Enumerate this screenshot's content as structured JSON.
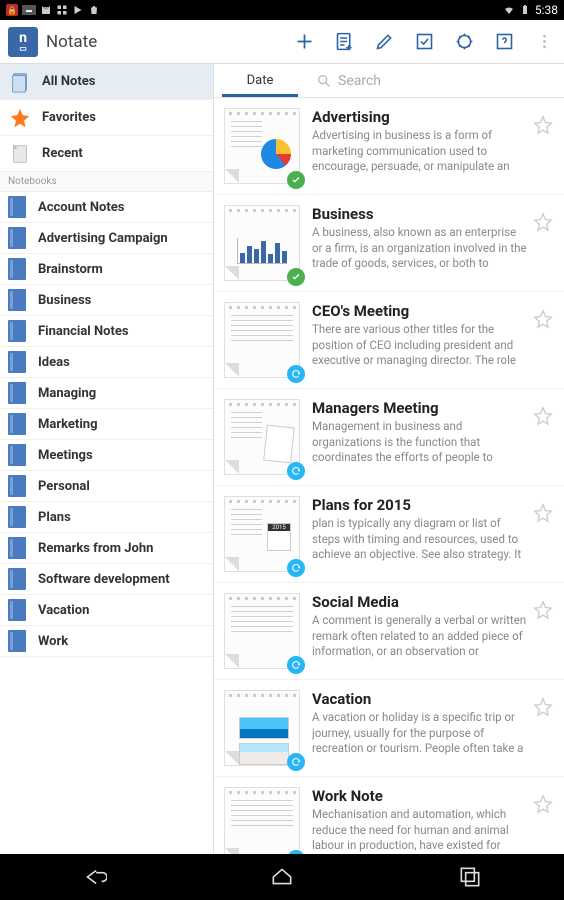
{
  "status": {
    "time": "5:38"
  },
  "header": {
    "title": "Notate",
    "actions": [
      "add",
      "add-note",
      "pen",
      "checkbox",
      "settings",
      "help",
      "overflow"
    ]
  },
  "sidebar": {
    "nav": [
      {
        "id": "all",
        "label": "All Notes",
        "selected": true
      },
      {
        "id": "favorites",
        "label": "Favorites"
      },
      {
        "id": "recent",
        "label": "Recent"
      }
    ],
    "section": "Notebooks",
    "notebooks": [
      {
        "label": "Account Notes"
      },
      {
        "label": "Advertising Campaign"
      },
      {
        "label": "Brainstorm"
      },
      {
        "label": "Business"
      },
      {
        "label": "Financial Notes"
      },
      {
        "label": "Ideas"
      },
      {
        "label": "Managing"
      },
      {
        "label": "Marketing"
      },
      {
        "label": "Meetings"
      },
      {
        "label": "Personal"
      },
      {
        "label": "Plans"
      },
      {
        "label": "Remarks from John"
      },
      {
        "label": "Software development"
      },
      {
        "label": "Vacation"
      },
      {
        "label": "Work"
      }
    ]
  },
  "content": {
    "tab_date": "Date",
    "search_placeholder": "Search",
    "notes": [
      {
        "title": "Advertising",
        "desc": "Advertising in business is a form of marketing communication used to encourage, persuade, or manipulate an",
        "status": "ok",
        "thumb": "pie"
      },
      {
        "title": "Business",
        "desc": "A business, also known as an enterprise or a firm, is an organization involved in the trade of goods, services, or both to",
        "status": "ok",
        "thumb": "bars"
      },
      {
        "title": "CEO's Meeting",
        "desc": "There are various other titles for the position of CEO including president and executive or managing director. The role",
        "status": "sync",
        "thumb": "text"
      },
      {
        "title": "Managers Meeting",
        "desc": "Management in business and organizations is the function that coordinates the efforts of people to",
        "status": "sync",
        "thumb": "paper"
      },
      {
        "title": "Plans for 2015",
        "desc": "plan is typically any diagram or list of steps with timing and resources, used to achieve an objective. See also strategy. It",
        "status": "sync",
        "thumb": "cal"
      },
      {
        "title": "Social Media",
        "desc": "A comment is generally a verbal or written remark often related to an added piece of information, or an observation or",
        "status": "sync",
        "thumb": "text"
      },
      {
        "title": "Vacation",
        "desc": "A vacation or holiday is a specific trip or journey, usually for the purpose of recreation or tourism. People often take a",
        "status": "sync",
        "thumb": "photos"
      },
      {
        "title": "Work Note",
        "desc": "Mechanisation and automation, which reduce the need for human and animal labour in production, have existed for",
        "status": "sync",
        "thumb": "text"
      }
    ]
  }
}
